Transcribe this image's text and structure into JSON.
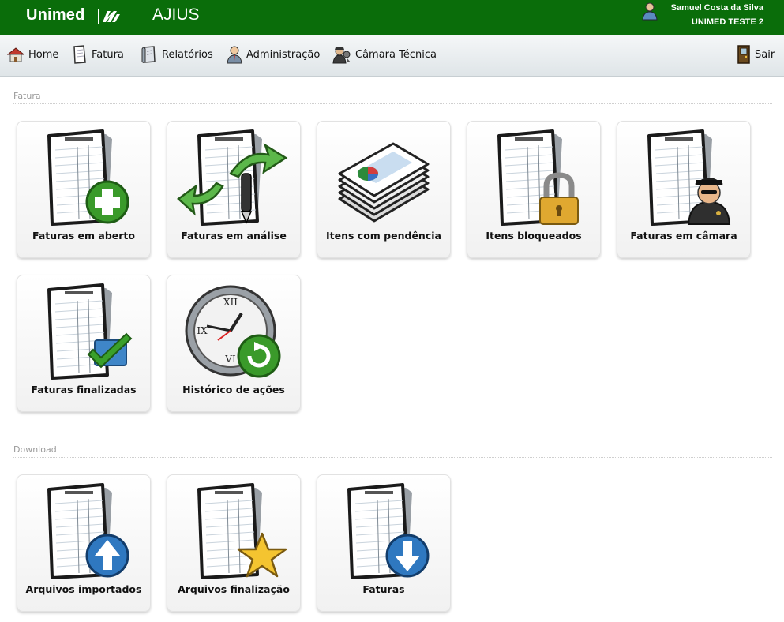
{
  "header": {
    "logo_text": "Unimed",
    "app_title": "AJIUS",
    "user_name": "Samuel Costa da Silva",
    "user_org": "UNIMED TESTE 2"
  },
  "nav": {
    "home": "Home",
    "fatura": "Fatura",
    "relatorios": "Relatórios",
    "administracao": "Administração",
    "camara_tecnica": "Câmara Técnica",
    "sair": "Sair"
  },
  "sections": {
    "fatura": {
      "title": "Fatura",
      "tiles": [
        {
          "label": "Faturas em aberto",
          "icon": "document-add-icon"
        },
        {
          "label": "Faturas em análise",
          "icon": "document-pen-arrows-icon"
        },
        {
          "label": "Itens com pendência",
          "icon": "stack-pie-chart-icon"
        },
        {
          "label": "Itens bloqueados",
          "icon": "document-lock-icon"
        },
        {
          "label": "Faturas em câmara",
          "icon": "document-officer-icon"
        },
        {
          "label": "Faturas finalizadas",
          "icon": "document-check-icon"
        },
        {
          "label": "Histórico de ações",
          "icon": "clock-history-icon"
        }
      ]
    },
    "download": {
      "title": "Download",
      "tiles": [
        {
          "label": "Arquivos importados",
          "icon": "document-upload-icon"
        },
        {
          "label": "Arquivos finalização",
          "icon": "document-star-icon"
        },
        {
          "label": "Faturas",
          "icon": "document-download-icon"
        }
      ]
    }
  },
  "colors": {
    "brand_green": "#0a6d0a",
    "nav_gradient_top": "#f5f7f8",
    "nav_gradient_bottom": "#dfe5e8",
    "section_title": "#9a9a9a"
  }
}
